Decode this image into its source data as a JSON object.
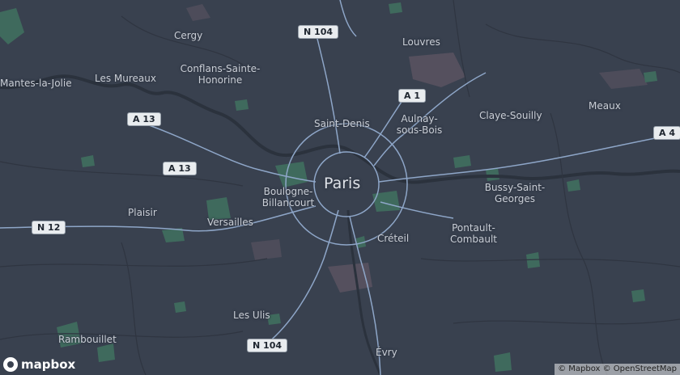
{
  "map": {
    "places": [
      {
        "id": "cergy",
        "name": "Cergy",
        "size": "normal"
      },
      {
        "id": "louvres",
        "name": "Louvres",
        "size": "normal"
      },
      {
        "id": "conflans",
        "name": "Conflans-Sainte-\nHonorine",
        "size": "normal"
      },
      {
        "id": "mantes",
        "name": "Mantes-la-Jolie",
        "size": "normal"
      },
      {
        "id": "mureaux",
        "name": "Les Mureaux",
        "size": "normal"
      },
      {
        "id": "saint-denis",
        "name": "Saint-Denis",
        "size": "normal"
      },
      {
        "id": "aulnay",
        "name": "Aulnay-\nsous-Bois",
        "size": "normal"
      },
      {
        "id": "claye",
        "name": "Claye-Souilly",
        "size": "normal"
      },
      {
        "id": "meaux",
        "name": "Meaux",
        "size": "normal"
      },
      {
        "id": "paris",
        "name": "Paris",
        "size": "big"
      },
      {
        "id": "boulogne",
        "name": "Boulogne-\nBillancourt",
        "size": "normal"
      },
      {
        "id": "bussy",
        "name": "Bussy-Saint-\nGeorges",
        "size": "normal"
      },
      {
        "id": "plaisir",
        "name": "Plaisir",
        "size": "normal"
      },
      {
        "id": "versailles",
        "name": "Versailles",
        "size": "normal"
      },
      {
        "id": "creteil",
        "name": "Créteil",
        "size": "normal"
      },
      {
        "id": "pontault",
        "name": "Pontault-\nCombault",
        "size": "normal"
      },
      {
        "id": "ulis",
        "name": "Les Ulis",
        "size": "normal"
      },
      {
        "id": "rambouillet",
        "name": "Rambouillet",
        "size": "normal"
      },
      {
        "id": "evry",
        "name": "Évry",
        "size": "normal"
      }
    ],
    "shields": [
      {
        "id": "n104-north",
        "label": "N 104"
      },
      {
        "id": "a1",
        "label": "A 1"
      },
      {
        "id": "a13-west",
        "label": "A 13"
      },
      {
        "id": "a13-center",
        "label": "A 13"
      },
      {
        "id": "a4",
        "label": "A 4"
      },
      {
        "id": "n12",
        "label": "N 12"
      },
      {
        "id": "n104-south",
        "label": "N 104"
      }
    ],
    "logo_text": "mapbox",
    "attribution": "© Mapbox © OpenStreetMap",
    "colors": {
      "land": "#39414f",
      "water": "#2b323d",
      "park": "#3f6a5d",
      "urban": "#5a5663",
      "roads": "#8ea6c8"
    }
  }
}
